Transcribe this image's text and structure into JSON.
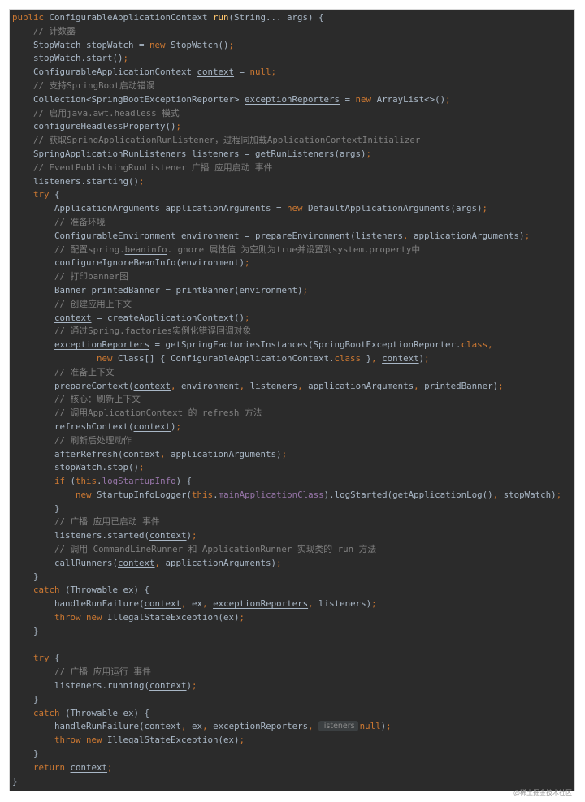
{
  "editor": {
    "theme": "darcula",
    "colors": {
      "background": "#2b2b2b",
      "default": "#a9b7c6",
      "keyword": "#cc7832",
      "method": "#ffc66d",
      "comment": "#808080",
      "field": "#9876aa"
    },
    "lines": [
      [
        {
          "t": "public ",
          "c": "kw"
        },
        {
          "t": "ConfigurableApplicationContext "
        },
        {
          "t": "run",
          "c": "fn"
        },
        {
          "t": "(String... args) {"
        }
      ],
      [
        {
          "t": "    // 计数器",
          "c": "cm"
        }
      ],
      [
        {
          "t": "    StopWatch stopWatch = "
        },
        {
          "t": "new ",
          "c": "kw"
        },
        {
          "t": "StopWatch()"
        },
        {
          "t": ";",
          "c": "kw"
        }
      ],
      [
        {
          "t": "    stopWatch.start()"
        },
        {
          "t": ";",
          "c": "kw"
        }
      ],
      [
        {
          "t": "    ConfigurableApplicationContext "
        },
        {
          "t": "context",
          "c": "ul"
        },
        {
          "t": " = "
        },
        {
          "t": "null;",
          "c": "kw"
        }
      ],
      [
        {
          "t": "    // 支持SpringBoot启动错误",
          "c": "cm"
        }
      ],
      [
        {
          "t": "    Collection<SpringBootExceptionReporter> "
        },
        {
          "t": "exceptionReporters",
          "c": "ul"
        },
        {
          "t": " = "
        },
        {
          "t": "new ",
          "c": "kw"
        },
        {
          "t": "ArrayList<>()"
        },
        {
          "t": ";",
          "c": "kw"
        }
      ],
      [
        {
          "t": "    // 启用java.awt.headless 模式",
          "c": "cm"
        }
      ],
      [
        {
          "t": "    configureHeadlessProperty()"
        },
        {
          "t": ";",
          "c": "kw"
        }
      ],
      [
        {
          "t": "    // 获取SpringApplicationRunListener，过程同加载ApplicationContextInitializer",
          "c": "cm"
        }
      ],
      [
        {
          "t": "    SpringApplicationRunListeners listeners = getRunListeners(args)"
        },
        {
          "t": ";",
          "c": "kw"
        }
      ],
      [
        {
          "t": "    // EventPublishingRunListener 广播 应用启动 事件",
          "c": "cm"
        }
      ],
      [
        {
          "t": "    listeners.starting()"
        },
        {
          "t": ";",
          "c": "kw"
        }
      ],
      [
        {
          "t": "    try ",
          "c": "kw"
        },
        {
          "t": "{"
        }
      ],
      [
        {
          "t": "        ApplicationArguments applicationArguments = "
        },
        {
          "t": "new ",
          "c": "kw"
        },
        {
          "t": "DefaultApplicationArguments(args)"
        },
        {
          "t": ";",
          "c": "kw"
        }
      ],
      [
        {
          "t": "        // 准备环境",
          "c": "cm"
        }
      ],
      [
        {
          "t": "        ConfigurableEnvironment environment = prepareEnvironment(listeners"
        },
        {
          "t": ", ",
          "c": "kw"
        },
        {
          "t": "applicationArguments)"
        },
        {
          "t": ";",
          "c": "kw"
        }
      ],
      [
        {
          "t": "        // 配置spring.",
          "c": "cm"
        },
        {
          "t": "beaninfo",
          "c": "cm ul"
        },
        {
          "t": ".ignore 属性值 为空则为true并设置到system.property中",
          "c": "cm"
        }
      ],
      [
        {
          "t": "        configureIgnoreBeanInfo(environment)"
        },
        {
          "t": ";",
          "c": "kw"
        }
      ],
      [
        {
          "t": "        // 打印banner图",
          "c": "cm"
        }
      ],
      [
        {
          "t": "        Banner printedBanner = printBanner(environment)"
        },
        {
          "t": ";",
          "c": "kw"
        }
      ],
      [
        {
          "t": "        // 创建应用上下文",
          "c": "cm"
        }
      ],
      [
        {
          "t": "        "
        },
        {
          "t": "context",
          "c": "ul"
        },
        {
          "t": " = createApplicationContext()"
        },
        {
          "t": ";",
          "c": "kw"
        }
      ],
      [
        {
          "t": "        // 通过Spring.factories实例化错误回调对象",
          "c": "cm"
        }
      ],
      [
        {
          "t": "        "
        },
        {
          "t": "exceptionReporters",
          "c": "ul"
        },
        {
          "t": " = getSpringFactoriesInstances(SpringBootExceptionReporter."
        },
        {
          "t": "class,",
          "c": "kw"
        }
      ],
      [
        {
          "t": "                "
        },
        {
          "t": "new ",
          "c": "kw"
        },
        {
          "t": "Class[] { ConfigurableApplicationContext."
        },
        {
          "t": "class ",
          "c": "kw"
        },
        {
          "t": "}"
        },
        {
          "t": ", ",
          "c": "kw"
        },
        {
          "t": "context",
          "c": "ul"
        },
        {
          "t": ")"
        },
        {
          "t": ";",
          "c": "kw"
        }
      ],
      [
        {
          "t": "        // 准备上下文",
          "c": "cm"
        }
      ],
      [
        {
          "t": "        prepareContext("
        },
        {
          "t": "context",
          "c": "ul"
        },
        {
          "t": ", ",
          "c": "kw"
        },
        {
          "t": "environment"
        },
        {
          "t": ", ",
          "c": "kw"
        },
        {
          "t": "listeners"
        },
        {
          "t": ", ",
          "c": "kw"
        },
        {
          "t": "applicationArguments"
        },
        {
          "t": ", ",
          "c": "kw"
        },
        {
          "t": "printedBanner)"
        },
        {
          "t": ";",
          "c": "kw"
        }
      ],
      [
        {
          "t": "        // 核心：刷新上下文",
          "c": "cm"
        }
      ],
      [
        {
          "t": "        // 调用ApplicationContext 的 refresh 方法",
          "c": "cm"
        }
      ],
      [
        {
          "t": "        refreshContext("
        },
        {
          "t": "context",
          "c": "ul"
        },
        {
          "t": ")"
        },
        {
          "t": ";",
          "c": "kw"
        }
      ],
      [
        {
          "t": "        // 刷新后处理动作",
          "c": "cm"
        }
      ],
      [
        {
          "t": "        afterRefresh("
        },
        {
          "t": "context",
          "c": "ul"
        },
        {
          "t": ", ",
          "c": "kw"
        },
        {
          "t": "applicationArguments)"
        },
        {
          "t": ";",
          "c": "kw"
        }
      ],
      [
        {
          "t": "        stopWatch.stop()"
        },
        {
          "t": ";",
          "c": "kw"
        }
      ],
      [
        {
          "t": "        if ",
          "c": "kw"
        },
        {
          "t": "("
        },
        {
          "t": "this",
          "c": "kw"
        },
        {
          "t": "."
        },
        {
          "t": "logStartupInfo",
          "c": "fld"
        },
        {
          "t": ") {"
        }
      ],
      [
        {
          "t": "            "
        },
        {
          "t": "new ",
          "c": "kw"
        },
        {
          "t": "StartupInfoLogger("
        },
        {
          "t": "this",
          "c": "kw"
        },
        {
          "t": "."
        },
        {
          "t": "mainApplicationClass",
          "c": "fld"
        },
        {
          "t": ").logStarted(getApplicationLog()"
        },
        {
          "t": ", ",
          "c": "kw"
        },
        {
          "t": "stopWatch)"
        },
        {
          "t": ";",
          "c": "kw"
        }
      ],
      [
        {
          "t": "        }"
        }
      ],
      [
        {
          "t": "        // 广播 应用已启动 事件",
          "c": "cm"
        }
      ],
      [
        {
          "t": "        listeners.started("
        },
        {
          "t": "context",
          "c": "ul"
        },
        {
          "t": ")"
        },
        {
          "t": ";",
          "c": "kw"
        }
      ],
      [
        {
          "t": "        // 调用 CommandLineRunner 和 ApplicationRunner 实现类的 run 方法",
          "c": "cm"
        }
      ],
      [
        {
          "t": "        callRunners("
        },
        {
          "t": "context",
          "c": "ul"
        },
        {
          "t": ", ",
          "c": "kw"
        },
        {
          "t": "applicationArguments)"
        },
        {
          "t": ";",
          "c": "kw"
        }
      ],
      [
        {
          "t": "    }"
        }
      ],
      [
        {
          "t": "    catch ",
          "c": "kw"
        },
        {
          "t": "(Throwable ex) {"
        }
      ],
      [
        {
          "t": "        handleRunFailure("
        },
        {
          "t": "context",
          "c": "ul"
        },
        {
          "t": ", ",
          "c": "kw"
        },
        {
          "t": "ex"
        },
        {
          "t": ", ",
          "c": "kw"
        },
        {
          "t": "exceptionReporters",
          "c": "ul"
        },
        {
          "t": ", ",
          "c": "kw"
        },
        {
          "t": "listeners)"
        },
        {
          "t": ";",
          "c": "kw"
        }
      ],
      [
        {
          "t": "        throw new ",
          "c": "kw"
        },
        {
          "t": "IllegalStateException(ex)"
        },
        {
          "t": ";",
          "c": "kw"
        }
      ],
      [
        {
          "t": "    }"
        }
      ],
      [
        {
          "t": ""
        }
      ],
      [
        {
          "t": "    try ",
          "c": "kw"
        },
        {
          "t": "{"
        }
      ],
      [
        {
          "t": "        // 广播 应用运行 事件",
          "c": "cm"
        }
      ],
      [
        {
          "t": "        listeners.running("
        },
        {
          "t": "context",
          "c": "ul"
        },
        {
          "t": ")"
        },
        {
          "t": ";",
          "c": "kw"
        }
      ],
      [
        {
          "t": "    }"
        }
      ],
      [
        {
          "t": "    catch ",
          "c": "kw"
        },
        {
          "t": "(Throwable ex) {"
        }
      ],
      [
        {
          "t": "        handleRunFailure("
        },
        {
          "t": "context",
          "c": "ul"
        },
        {
          "t": ", ",
          "c": "kw"
        },
        {
          "t": "ex"
        },
        {
          "t": ", ",
          "c": "kw"
        },
        {
          "t": "exceptionReporters",
          "c": "ul"
        },
        {
          "t": ", ",
          "c": "kw"
        },
        {
          "t": "listeners",
          "c": "hint"
        },
        {
          "t": "null",
          "c": "kw"
        },
        {
          "t": ")"
        },
        {
          "t": ";",
          "c": "kw"
        }
      ],
      [
        {
          "t": "        throw new ",
          "c": "kw"
        },
        {
          "t": "IllegalStateException(ex)"
        },
        {
          "t": ";",
          "c": "kw"
        }
      ],
      [
        {
          "t": "    }"
        }
      ],
      [
        {
          "t": "    return ",
          "c": "kw"
        },
        {
          "t": "context",
          "c": "ul"
        },
        {
          "t": ";",
          "c": "kw"
        }
      ],
      [
        {
          "t": "}"
        }
      ]
    ]
  },
  "watermark": "@稀土掘金技术社区"
}
